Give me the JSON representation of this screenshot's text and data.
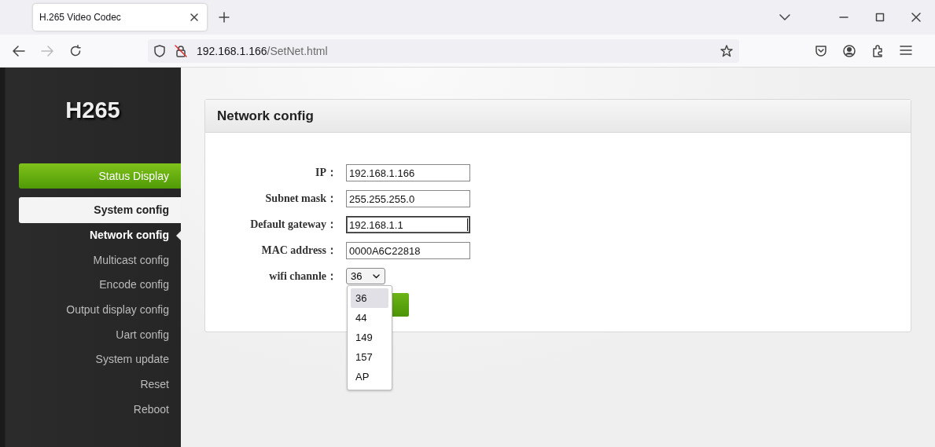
{
  "browser": {
    "tab": {
      "title": "H.265 Video Codec"
    },
    "address": {
      "host": "192.168.1.166",
      "path": "/SetNet.html"
    }
  },
  "sidebar": {
    "logo": "H265",
    "items": [
      {
        "label": "Status Display",
        "kind": "button"
      },
      {
        "label": "System config",
        "kind": "section"
      },
      {
        "label": "Network config",
        "kind": "link",
        "selected": true
      },
      {
        "label": "Multicast config",
        "kind": "link",
        "selected": false
      },
      {
        "label": "Encode config",
        "kind": "link",
        "selected": false
      },
      {
        "label": "Output display config",
        "kind": "link",
        "selected": false
      },
      {
        "label": "Uart config",
        "kind": "link",
        "selected": false
      },
      {
        "label": "System update",
        "kind": "link",
        "selected": false
      },
      {
        "label": "Reset",
        "kind": "link",
        "selected": false
      },
      {
        "label": "Reboot",
        "kind": "link",
        "selected": false
      }
    ]
  },
  "panel": {
    "title": "Network config",
    "fields": [
      {
        "label": "IP：",
        "kind": "text",
        "value": "192.168.1.166",
        "focused": false
      },
      {
        "label": "Subnet mask：",
        "kind": "text",
        "value": "255.255.255.0",
        "focused": false
      },
      {
        "label": "Default gateway：",
        "kind": "text",
        "value": "192.168.1.1",
        "focused": true
      },
      {
        "label": "MAC address：",
        "kind": "text",
        "value": "0000A6C22818",
        "focused": false
      },
      {
        "label": "wifi channle：",
        "kind": "select",
        "value": "36",
        "expanded": true,
        "options": [
          {
            "label": "36",
            "selected": true
          },
          {
            "label": "44",
            "selected": false
          },
          {
            "label": "149",
            "selected": false
          },
          {
            "label": "157",
            "selected": false
          },
          {
            "label": "AP",
            "selected": false
          }
        ]
      }
    ]
  }
}
